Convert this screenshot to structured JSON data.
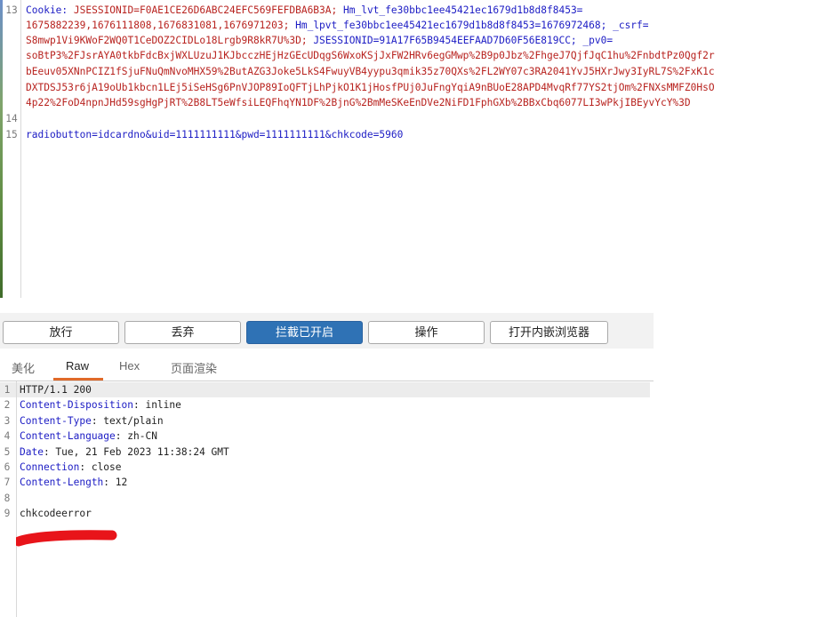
{
  "request": {
    "lines": [
      {
        "num": "13",
        "parts": [
          {
            "t": "Cookie: ",
            "c": "k"
          },
          {
            "t": "JSESSIONID=F0AE1CE26D6ABC24EFC569FEFDBA6B3A; ",
            "c": "v"
          },
          {
            "t": "Hm_lvt_fe30bbc1ee45421ec1679d1b8d8f8453=",
            "c": "k"
          }
        ]
      },
      {
        "num": "",
        "parts": [
          {
            "t": "1675882239,1676111808,1676831081,1676971203; ",
            "c": "v"
          },
          {
            "t": "Hm_lpvt_fe30bbc1ee45421ec1679d1b8d8f8453=1676972468; ",
            "c": "k"
          },
          {
            "t": "_csrf=",
            "c": "k"
          }
        ]
      },
      {
        "num": "",
        "parts": [
          {
            "t": "S8mwp1Vi9KWoF2WQ0T1CeDOZ2CIDLo18Lrgb9R8kR7U%3D; ",
            "c": "v"
          },
          {
            "t": "JSESSIONID=91A17F65B9454EEFAAD7D60F56E819CC; ",
            "c": "k"
          },
          {
            "t": "_pv0=",
            "c": "k"
          }
        ]
      },
      {
        "num": "",
        "parts": [
          {
            "t": "soBtP3%2FJsrAYA0tkbFdcBxjWXLUzuJ1KJbcczHEjHzGEcUDqgS6WxoKSjJxFW2HRv6egGMwp%2B9p0Jbz%2FhgeJ7QjfJqC1hu%2FnbdtPz0Qgf2r",
            "c": "v"
          }
        ]
      },
      {
        "num": "",
        "parts": [
          {
            "t": "bEeuv05XNnPCIZ1fSjuFNuQmNvoMHX59%2ButAZG3Joke5LkS4FwuyVB4yypu3qmik35z70QXs%2FL2WY07c3RA2041YvJ5HXrJwy3IyRL7S%2FxK1c",
            "c": "v"
          }
        ]
      },
      {
        "num": "",
        "parts": [
          {
            "t": "DXTDSJ53r6jA19oUb1kbcn1LEj5iSeHSg6PnVJOP89IoQFTjLhPjkO1K1jHosfPUj0JuFngYqiA9nBUoE28APD4MvqRf77YS2tjOm%2FNXsMMFZ0HsO",
            "c": "v"
          }
        ]
      },
      {
        "num": "",
        "parts": [
          {
            "t": "4p22%2FoD4npnJHd59sgHgPjRT%2B8LT5eWfsiLEQFhqYN1DF%2BjnG%2BmMeSKeEnDVe2NiFD1FphGXb%2BBxCbq6077LI3wPkjIBEyvYcY%3D",
            "c": "v"
          }
        ]
      },
      {
        "num": "14",
        "parts": []
      },
      {
        "num": "15",
        "parts": [
          {
            "t": "radiobutton=idcardno&uid=1111111111&pwd=1111111111&chkcode=5960",
            "c": "k"
          }
        ]
      }
    ]
  },
  "toolbar": {
    "buttons": [
      {
        "label": "放行",
        "name": "forward-button",
        "active": false
      },
      {
        "label": "丢弃",
        "name": "drop-button",
        "active": false
      },
      {
        "label": "拦截已开启",
        "name": "intercept-on-button",
        "active": true
      },
      {
        "label": "操作",
        "name": "action-button",
        "active": false
      },
      {
        "label": "打开内嵌浏览器",
        "name": "open-browser-button",
        "active": false
      }
    ]
  },
  "tabs": [
    {
      "label": "美化",
      "name": "tab-pretty",
      "selected": false
    },
    {
      "label": "Raw",
      "name": "tab-raw",
      "selected": true
    },
    {
      "label": "Hex",
      "name": "tab-hex",
      "selected": false
    },
    {
      "label": "页面渲染",
      "name": "tab-render",
      "selected": false
    }
  ],
  "response": {
    "lines": [
      {
        "num": "1",
        "key": "HTTP/1.1 200",
        "val": "",
        "plain": true
      },
      {
        "num": "2",
        "key": "Content-Disposition",
        "val": ": inline"
      },
      {
        "num": "3",
        "key": "Content-Type",
        "val": ": text/plain"
      },
      {
        "num": "4",
        "key": "Content-Language",
        "val": ": zh-CN"
      },
      {
        "num": "5",
        "key": "Date",
        "val": ": Tue, 21 Feb 2023 11:38:24 GMT"
      },
      {
        "num": "6",
        "key": "Connection",
        "val": ": close"
      },
      {
        "num": "7",
        "key": "Content-Length",
        "val": ": 12"
      },
      {
        "num": "8",
        "key": "",
        "val": ""
      },
      {
        "num": "9",
        "key": "chkcodeerror",
        "val": "",
        "plain": true
      }
    ]
  },
  "colors": {
    "accent": "#2f72b5",
    "tab_underline": "#e06a2a",
    "header_key": "#1c1cc4",
    "value_red": "#b8231f",
    "annotation_red": "#e8141a"
  }
}
